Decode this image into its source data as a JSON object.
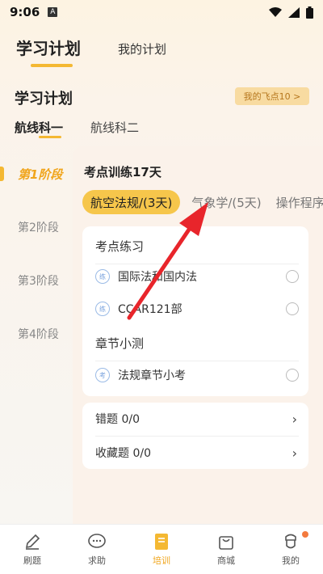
{
  "status": {
    "time": "9:06",
    "notif_icon": "A"
  },
  "top_tabs": [
    {
      "label": "学习计划"
    },
    {
      "label": "我的计划"
    }
  ],
  "plan": {
    "title": "学习计划",
    "fly_badge": "我的飞点10 >"
  },
  "subjects": [
    {
      "label": "航线科一"
    },
    {
      "label": "航线科二"
    }
  ],
  "stages": [
    {
      "label": "第1阶段"
    },
    {
      "label": "第2阶段"
    },
    {
      "label": "第3阶段"
    },
    {
      "label": "第4阶段"
    }
  ],
  "panel": {
    "title": "考点训练17天",
    "topics": [
      {
        "label": "航空法规/(3天)"
      },
      {
        "label": "气象学/(5天)"
      },
      {
        "label": "操作程序"
      }
    ],
    "section1": "考点练习",
    "practice": [
      {
        "icon": "练",
        "label": "国际法和国内法"
      },
      {
        "icon": "练",
        "label": "CCAR121部"
      }
    ],
    "section2": "章节小测",
    "quiz": [
      {
        "icon": "考",
        "label": "法规章节小考"
      }
    ],
    "mistakes": "错题 0/0",
    "favorites": "收藏题 0/0"
  },
  "bottom_nav": [
    {
      "label": "刷题",
      "icon": "pen-icon"
    },
    {
      "label": "求助",
      "icon": "chat-icon"
    },
    {
      "label": "培训",
      "icon": "book-icon"
    },
    {
      "label": "商城",
      "icon": "bag-icon"
    },
    {
      "label": "我的",
      "icon": "user-icon"
    }
  ],
  "colors": {
    "accent": "#f4b832",
    "arrow": "#e8252b"
  }
}
